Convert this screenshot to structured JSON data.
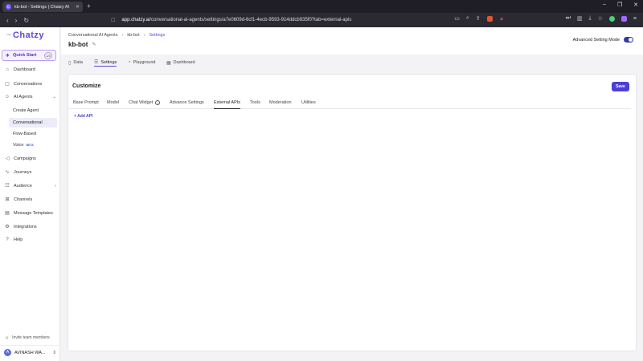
{
  "browser": {
    "tab_title": "kb-bot - Settings | Chatzy AI",
    "tab_favicon": "C",
    "url_host": "app.chatzy.ai",
    "url_path": "/conversational-ai-agents/settings/a7e0609d-6cf1-4ecb-9593-914ddcb935f0?tab=external-apis"
  },
  "sidebar": {
    "logo": "Chatzy",
    "quick_start": {
      "label": "Quick Start",
      "badge": "1/3"
    },
    "items": [
      {
        "label": "Dashboard",
        "icon": "home-icon"
      },
      {
        "label": "Conversations",
        "icon": "chat-icon"
      },
      {
        "label": "AI Agents",
        "icon": "bot-icon"
      },
      {
        "label": "Campaigns",
        "icon": "megaphone-icon"
      },
      {
        "label": "Journeys",
        "icon": "route-icon"
      },
      {
        "label": "Audience",
        "icon": "users-icon"
      },
      {
        "label": "Channels",
        "icon": "channels-icon"
      },
      {
        "label": "Message Templates",
        "icon": "template-icon"
      },
      {
        "label": "Integrations",
        "icon": "gear-icon"
      },
      {
        "label": "Help",
        "icon": "help-icon"
      }
    ],
    "ai_agents_sub": [
      {
        "label": "Create Agent"
      },
      {
        "label": "Conversational"
      },
      {
        "label": "Flow-Based"
      },
      {
        "label": "Voice",
        "badge": "BETA"
      }
    ],
    "invite": "Invite team members",
    "user": {
      "initial": "A",
      "name": "AVINASH WA..."
    }
  },
  "header": {
    "breadcrumbs": [
      "Conversational AI Agents",
      "kb-bot",
      "Settings"
    ],
    "bot_name": "kb-bot",
    "advanced_mode_label": "Advanced Setting Mode",
    "advanced_mode_on": true
  },
  "subtabs": [
    "Data",
    "Settings",
    "Playground",
    "Dashboard"
  ],
  "card": {
    "title": "Customize",
    "save_label": "Save",
    "tabs": [
      "Base Prompt",
      "Model",
      "Chat Widget",
      "Advance Settings",
      "External APIs",
      "Tools",
      "Moderation",
      "Utilities"
    ],
    "active_tab": "External APIs",
    "add_api_label": "+ Add API"
  },
  "colors": {
    "accent": "#4b3fd9",
    "brand": "#5b4bd6"
  }
}
